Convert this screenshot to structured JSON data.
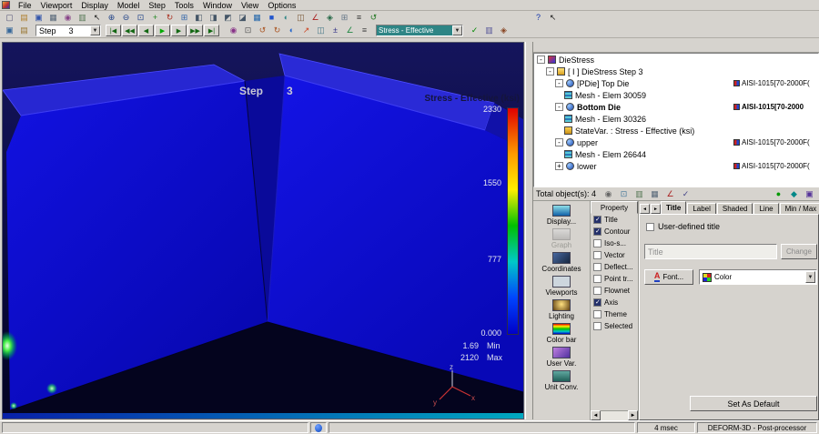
{
  "colors": {
    "panel_bg": "#d6d3ce",
    "selection_teal": "#2e8585",
    "viewport_bg": "#0a0a40",
    "die_blue": "#0d0dd0",
    "legend_gradient": [
      "#e00000",
      "#ff9900",
      "#ffee00",
      "#00c000",
      "#00c8c8",
      "#0044ff",
      "#0000c8"
    ]
  },
  "menubar": {
    "items": [
      {
        "name": "menu-file",
        "label": "File"
      },
      {
        "name": "menu-viewport",
        "label": "Viewport"
      },
      {
        "name": "menu-display",
        "label": "Display"
      },
      {
        "name": "menu-model",
        "label": "Model"
      },
      {
        "name": "menu-step",
        "label": "Step"
      },
      {
        "name": "menu-tools",
        "label": "Tools"
      },
      {
        "name": "menu-window",
        "label": "Window"
      },
      {
        "name": "menu-view",
        "label": "View"
      },
      {
        "name": "menu-options",
        "label": "Options"
      }
    ]
  },
  "toolbar_top": {
    "icons": [
      {
        "n": "new-document-icon",
        "g": "▢",
        "c": "#555577"
      },
      {
        "n": "open-folder-icon",
        "g": "▤",
        "c": "#b08030"
      },
      {
        "n": "save-icon",
        "g": "▣",
        "c": "#3355aa"
      },
      {
        "n": "print-icon",
        "g": "▦",
        "c": "#556677"
      },
      {
        "n": "snapshot-icon",
        "g": "◉",
        "c": "#884488"
      },
      {
        "n": "copy-icon",
        "g": "▥",
        "c": "#557755"
      },
      {
        "n": "pointer-icon",
        "g": "↖",
        "c": "#222222"
      },
      {
        "n": "zoom-in-icon",
        "g": "⊕",
        "c": "#224488"
      },
      {
        "n": "zoom-out-icon",
        "g": "⊖",
        "c": "#224488"
      },
      {
        "n": "zoom-window-icon",
        "g": "⊡",
        "c": "#224488"
      },
      {
        "n": "pan-icon",
        "g": "+",
        "c": "#228822"
      },
      {
        "n": "rotate-icon",
        "g": "↻",
        "c": "#aa3322"
      },
      {
        "n": "fit-view-icon",
        "g": "⊞",
        "c": "#3366aa"
      },
      {
        "n": "front-view-icon",
        "g": "◧",
        "c": "#445566"
      },
      {
        "n": "side-view-icon",
        "g": "◨",
        "c": "#445566"
      },
      {
        "n": "top-view-icon",
        "g": "◩",
        "c": "#445566"
      },
      {
        "n": "iso-view-icon",
        "g": "◪",
        "c": "#445566"
      },
      {
        "n": "wireframe-icon",
        "g": "▦",
        "c": "#2266aa"
      },
      {
        "n": "shaded-icon",
        "g": "■",
        "c": "#2255cc"
      },
      {
        "n": "half-shade-icon",
        "g": "◐",
        "c": "#338888"
      },
      {
        "n": "slice-icon",
        "g": "◫",
        "c": "#775533"
      },
      {
        "n": "measure-icon",
        "g": "∠",
        "c": "#aa2222"
      },
      {
        "n": "annotate-icon",
        "g": "◈",
        "c": "#226644"
      },
      {
        "n": "grid-icon",
        "g": "⊞",
        "c": "#667788"
      },
      {
        "n": "options-icon",
        "g": "≡",
        "c": "#333333"
      },
      {
        "n": "refresh-icon",
        "g": "↺",
        "c": "#227722"
      }
    ],
    "help_icons": [
      {
        "n": "help-icon",
        "g": "?",
        "c": "#1133aa"
      },
      {
        "n": "context-pointer-icon",
        "g": "↖",
        "c": "#222222"
      }
    ]
  },
  "toolbar_step": {
    "lead_icons": [
      {
        "n": "save-keyframe-icon",
        "g": "▣",
        "c": "#336699"
      },
      {
        "n": "load-database-icon",
        "g": "▤",
        "c": "#997733"
      }
    ],
    "step_combo": {
      "label": "Step",
      "value": "3"
    },
    "nav": [
      {
        "n": "first-step-button",
        "g": "|◀",
        "c": "#116611"
      },
      {
        "n": "back-10-button",
        "g": "◀◀",
        "c": "#116611"
      },
      {
        "n": "back-button",
        "g": "◀",
        "c": "#116611"
      },
      {
        "n": "play-button",
        "g": "▶",
        "c": "#00aa00"
      },
      {
        "n": "forward-button",
        "g": "▶",
        "c": "#116611"
      },
      {
        "n": "forward-10-button",
        "g": "▶▶",
        "c": "#116611"
      },
      {
        "n": "last-step-button",
        "g": "▶|",
        "c": "#116611"
      }
    ],
    "mid_icons": [
      {
        "n": "animate-icon",
        "g": "◉",
        "c": "#883388"
      },
      {
        "n": "capture-icon",
        "g": "⊡",
        "c": "#555555"
      },
      {
        "n": "rotate-ccw-icon",
        "g": "↺",
        "c": "#aa5522"
      },
      {
        "n": "rotate-cw-icon",
        "g": "↻",
        "c": "#aa5522"
      },
      {
        "n": "contour-icon",
        "g": "◐",
        "c": "#2266cc"
      },
      {
        "n": "vector-icon",
        "g": "↗",
        "c": "#cc4422"
      },
      {
        "n": "slice-plane-icon",
        "g": "◫",
        "c": "#447788"
      },
      {
        "n": "min-max-icon",
        "g": "±",
        "c": "#333388"
      },
      {
        "n": "graph-tool-icon",
        "g": "∠",
        "c": "#228844"
      },
      {
        "n": "summary-icon",
        "g": "≡",
        "c": "#444444"
      }
    ],
    "state_combo": {
      "value": "Stress - Effective"
    },
    "trail_icons": [
      {
        "n": "apply-state-icon",
        "g": "✓",
        "c": "#008800"
      },
      {
        "n": "legend-icon",
        "g": "▥",
        "c": "#555599"
      },
      {
        "n": "palette-icon",
        "g": "◈",
        "c": "#884422"
      }
    ]
  },
  "viewport": {
    "step_label": "Step",
    "step_number": "3",
    "legend": {
      "title": "Stress - Effective (ksi)",
      "ticks": [
        "2330",
        "1550",
        "777",
        "0.000"
      ],
      "min_value": "1.69",
      "min_label": "Min",
      "max_value": "2120",
      "max_label": "Max"
    },
    "axes": {
      "x": "x",
      "y": "y",
      "z": "z"
    }
  },
  "tree": {
    "rows": [
      {
        "name": "tree-row-diestress-root",
        "indent": 0,
        "exp": "-",
        "icon": "root",
        "label": "DieStress",
        "bold": false
      },
      {
        "name": "tree-row-step",
        "indent": 1,
        "exp": "-",
        "icon": "step",
        "label": "[ I ]  DieStress  Step 3",
        "bold": false
      },
      {
        "name": "tree-row-top-die",
        "indent": 2,
        "exp": "-",
        "icon": "die",
        "label": "[PDie] Top Die",
        "bold": false,
        "mat": "AISI-1015[70-2000F("
      },
      {
        "name": "tree-row-top-die-mesh",
        "indent": 3,
        "exp": "",
        "icon": "mesh",
        "label": "Mesh - Elem 30059",
        "bold": false
      },
      {
        "name": "tree-row-bottom-die",
        "indent": 2,
        "exp": "-",
        "icon": "die",
        "label": "Bottom Die",
        "bold": true,
        "mat": "AISI-1015[70-2000"
      },
      {
        "name": "tree-row-bottom-die-mesh",
        "indent": 3,
        "exp": "",
        "icon": "mesh",
        "label": "Mesh - Elem 30326",
        "bold": false
      },
      {
        "name": "tree-row-statevar",
        "indent": 3,
        "exp": "",
        "icon": "statevar",
        "label": "StateVar. :  Stress - Effective (ksi)",
        "bold": false
      },
      {
        "name": "tree-row-upper",
        "indent": 2,
        "exp": "-",
        "icon": "die",
        "label": "upper",
        "bold": false,
        "mat": "AISI-1015[70-2000F("
      },
      {
        "name": "tree-row-upper-mesh",
        "indent": 3,
        "exp": "",
        "icon": "mesh",
        "label": "Mesh - Elem 26644",
        "bold": false
      },
      {
        "name": "tree-row-lower",
        "indent": 2,
        "exp": "+",
        "icon": "die",
        "label": "lower",
        "bold": false,
        "mat": "AISI-1015[70-2000F("
      }
    ]
  },
  "object_bar": {
    "total_label": "Total object(s): 4",
    "icons": [
      {
        "n": "snapshot-objects-icon",
        "g": "◉",
        "c": "#666666"
      },
      {
        "n": "mirror-icon",
        "g": "⊡",
        "c": "#447799"
      },
      {
        "n": "copy-object-icon",
        "g": "▥",
        "c": "#557755"
      },
      {
        "n": "print-tree-icon",
        "g": "▦",
        "c": "#556677"
      },
      {
        "n": "measure-objects-icon",
        "g": "∠",
        "c": "#aa2222"
      },
      {
        "n": "check-objects-icon",
        "g": "✓",
        "c": "#444488"
      }
    ],
    "status_icons": [
      {
        "n": "status-green-icon",
        "g": "●",
        "c": "#009900"
      },
      {
        "n": "status-teal-icon",
        "g": "◆",
        "c": "#008888"
      },
      {
        "n": "status-grid-icon",
        "g": "▣",
        "c": "#553399"
      }
    ]
  },
  "display_panel": {
    "items": [
      {
        "name": "display-item-display-settings",
        "label": "Display...",
        "icon": "display",
        "disabled": false
      },
      {
        "name": "display-item-graph",
        "label": "Graph",
        "icon": "graph",
        "disabled": true
      },
      {
        "name": "display-item-coordinates",
        "label": "Coordinates",
        "icon": "coordinates",
        "disabled": false
      },
      {
        "name": "display-item-viewports",
        "label": "Viewports",
        "icon": "viewports",
        "disabled": false
      },
      {
        "name": "display-item-lighting",
        "label": "Lighting",
        "icon": "lighting",
        "disabled": false
      },
      {
        "name": "display-item-color-bar",
        "label": "Color bar",
        "icon": "colorbar",
        "disabled": false
      },
      {
        "name": "display-item-user-var",
        "label": "User Var.",
        "icon": "uservar",
        "disabled": false
      },
      {
        "name": "display-item-unit-conv",
        "label": "Unit Conv.",
        "icon": "unitconv",
        "disabled": false
      }
    ]
  },
  "property": {
    "header": "Property",
    "rows": [
      {
        "name": "property-row-title",
        "label": "Title",
        "checked": true
      },
      {
        "name": "property-row-contour",
        "label": "Contour",
        "checked": true
      },
      {
        "name": "property-row-iso-surface",
        "label": "Iso-s...",
        "checked": false
      },
      {
        "name": "property-row-vector",
        "label": "Vector",
        "checked": false
      },
      {
        "name": "property-row-deflection",
        "label": "Deflect...",
        "checked": false
      },
      {
        "name": "property-row-point-tracking",
        "label": "Point tr...",
        "checked": false
      },
      {
        "name": "property-row-flownet",
        "label": "Flownet",
        "checked": false
      },
      {
        "name": "property-row-axis",
        "label": "Axis",
        "checked": true
      },
      {
        "name": "property-row-theme",
        "label": "Theme",
        "checked": false
      },
      {
        "name": "property-row-selected",
        "label": "Selected",
        "checked": false
      }
    ]
  },
  "settings": {
    "tabs": [
      {
        "name": "tab-title",
        "label": "Title",
        "active": true
      },
      {
        "name": "tab-label",
        "label": "Label",
        "active": false
      },
      {
        "name": "tab-shaded",
        "label": "Shaded",
        "active": false
      },
      {
        "name": "tab-line",
        "label": "Line",
        "active": false
      },
      {
        "name": "tab-min-max",
        "label": "Min / Max",
        "active": false
      }
    ],
    "tab_scroll_left": "◄",
    "tab_scroll_right": "►",
    "user_defined_title_label": "User-defined title",
    "title_field_text": "Title",
    "change_button": "Change",
    "font_button": "Font...",
    "font_icon_letter": "A",
    "color_combo_label": "Color",
    "set_as_default_button": "Set As Default"
  },
  "statusbar": {
    "timing": "4 msec",
    "app_name": "DEFORM-3D  -  Post-processor"
  }
}
